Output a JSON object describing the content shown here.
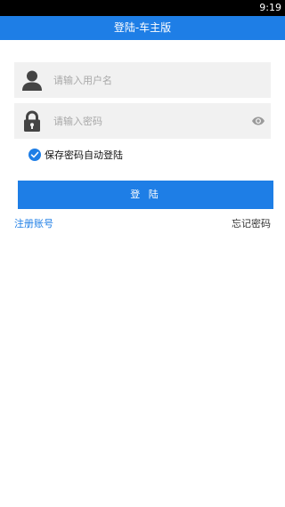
{
  "status_bar": {
    "time": "9:19"
  },
  "header": {
    "title": "登陆-车主版"
  },
  "login_form": {
    "username": {
      "placeholder": "请输入用户名",
      "value": "",
      "icon": "user-icon"
    },
    "password": {
      "placeholder": "请输入密码",
      "value": "",
      "icon": "lock-icon",
      "toggle_icon": "eye-icon"
    },
    "remember": {
      "label": "保存密码自动登陆",
      "checked": true
    },
    "submit_label": "登 陆"
  },
  "links": {
    "register": "注册账号",
    "forgot_password": "忘记密码"
  },
  "colors": {
    "primary": "#1e7ee6",
    "field_background": "#f1f1f1",
    "icon": "#444444"
  }
}
